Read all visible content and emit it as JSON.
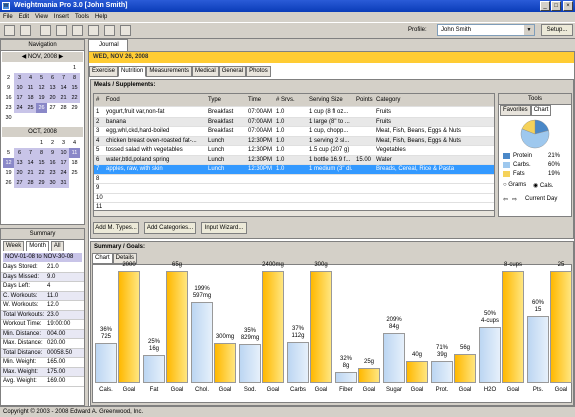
{
  "window": {
    "title": "Weightmania Pro 3.0 [John Smith]"
  },
  "menu": [
    "File",
    "Edit",
    "View",
    "Insert",
    "Tools",
    "Help"
  ],
  "profile": {
    "label": "Profile:",
    "value": "John Smith",
    "setup": "Setup..."
  },
  "navigation": {
    "title": "Navigation",
    "cal1": {
      "month": "NOV, 2008",
      "days": [
        "1",
        "2",
        "3",
        "4",
        "5",
        "6",
        "7",
        "8",
        "9",
        "10",
        "11",
        "12",
        "13",
        "14",
        "15",
        "16",
        "17",
        "18",
        "19",
        "20",
        "21",
        "22",
        "23",
        "24",
        "25",
        "26",
        "27",
        "28",
        "29",
        "30"
      ]
    },
    "cal2": {
      "month": "OCT, 2008",
      "days": [
        "1",
        "2",
        "3",
        "4",
        "5",
        "6",
        "7",
        "8",
        "9",
        "10",
        "11",
        "12",
        "13",
        "14",
        "15",
        "16",
        "17",
        "18",
        "19",
        "20",
        "21",
        "22",
        "23",
        "24",
        "25",
        "26",
        "27",
        "28",
        "29",
        "30",
        "31"
      ]
    }
  },
  "summary": {
    "title": "Summary",
    "tabs": [
      "Week",
      "Month",
      "All"
    ],
    "period": "NOV-01-08 to NOV-30-08",
    "rows": [
      [
        "Days Stored:",
        "21.0"
      ],
      [
        "Days Missed:",
        "9.0"
      ],
      [
        "Days Left:",
        "4"
      ],
      [
        "C. Workouts:",
        "11.0"
      ],
      [
        "W. Workouts:",
        "12.0"
      ],
      [
        "Total Workouts:",
        "23.0"
      ],
      [
        "Workout Time:",
        "19:00:00"
      ],
      [
        "Min. Distance:",
        "004.00"
      ],
      [
        "Max. Distance:",
        "020.00"
      ],
      [
        "Total Distance:",
        "00058.50"
      ],
      [
        "Min. Weight:",
        "165.00"
      ],
      [
        "Max. Weight:",
        "175.00"
      ],
      [
        "Avg. Weight:",
        "169.00"
      ]
    ]
  },
  "journal": {
    "tab": "Journal",
    "date": "WED, NOV 26, 2008",
    "subtabs": [
      "Exercise",
      "Nutrition",
      "Measurements",
      "Medical",
      "General",
      "Photos"
    ]
  },
  "meals": {
    "title": "Meals / Supplements:",
    "columns": [
      "#",
      "Food",
      "Type",
      "Time",
      "# Srvs.",
      "Serving Size",
      "Points",
      "Category"
    ],
    "rows": [
      [
        "1",
        "yogurt,fruit var,non-fat",
        "Breakfast",
        "07:00AM",
        "1.0",
        "1 cup (8 fl oz...",
        "",
        "Fruits"
      ],
      [
        "2",
        "banana",
        "Breakfast",
        "07:00AM",
        "1.0",
        "1 large (8\" to ...",
        "",
        "Fruits"
      ],
      [
        "3",
        "egg,whl,ckd,hard-boiled",
        "Breakfast",
        "07:00AM",
        "1.0",
        "1 cup, chopp...",
        "",
        "Meat, Fish, Beans, Eggs & Nuts"
      ],
      [
        "4",
        "chicken breast  oven-roasted  fat-...",
        "Lunch",
        "12:30PM",
        "1.0",
        "1 serving 2 sl...",
        "",
        "Meat, Fish, Beans, Eggs & Nuts"
      ],
      [
        "5",
        "tossed salad with vegetables",
        "Lunch",
        "12:30PM",
        "1.0",
        "1.5 cup (207 g)",
        "",
        "Vegetables"
      ],
      [
        "6",
        "water,btld,poland spring",
        "Lunch",
        "12:30PM",
        "1.0",
        "1 bottle 16.9 f...",
        "15.00",
        "Water"
      ],
      [
        "7",
        "apples, raw, with skin",
        "Lunch",
        "12:30PM",
        "1.0",
        "1 medium (3\" di...",
        "",
        "Breads, Cereal, Rice & Pasta"
      ],
      [
        "8",
        "",
        "",
        "",
        "",
        "",
        "",
        ""
      ],
      [
        "9",
        "",
        "",
        "",
        "",
        "",
        "",
        ""
      ],
      [
        "10",
        "",
        "",
        "",
        "",
        "",
        "",
        ""
      ],
      [
        "11",
        "",
        "",
        "",
        "",
        "",
        "",
        ""
      ]
    ],
    "buttons": [
      "Add M. Types...",
      "Add Categories...",
      "Input Wizard..."
    ]
  },
  "tools": {
    "title": "Tools",
    "tabs": [
      "Favorites",
      "Chart"
    ],
    "legend": [
      [
        "Protein",
        "21%"
      ],
      [
        "Carbs.",
        "60%"
      ],
      [
        "Fats",
        "19%"
      ]
    ],
    "radios": [
      "Grams",
      "Cals."
    ],
    "nav": "Current Day",
    "colors": [
      "#f5d25a",
      "#9ec8ee",
      "#4a88c8"
    ]
  },
  "goals": {
    "title": "Summary / Goals:",
    "tabs": [
      "Chart",
      "Details"
    ],
    "bars": [
      {
        "x": "Cals.",
        "pct": "36%",
        "val": "725",
        "f": 0.36,
        "goal": "2000",
        "gx": "Goal"
      },
      {
        "x": "Fat",
        "pct": "25%",
        "val": "16g",
        "f": 0.25,
        "goal": "65g",
        "gx": "Goal"
      },
      {
        "x": "Chol.",
        "pct": "199%",
        "val": "597mg",
        "f": 0.72,
        "goal": "300mg",
        "gx": "Goal",
        "gf": 0.36
      },
      {
        "x": "Sod.",
        "pct": "35%",
        "val": "829mg",
        "f": 0.35,
        "goal": "2400mg",
        "gx": "Goal"
      },
      {
        "x": "Carbs",
        "pct": "37%",
        "val": "112g",
        "f": 0.37,
        "goal": "300g",
        "gx": "Goal"
      },
      {
        "x": "Fiber",
        "pct": "32%",
        "val": "8g",
        "f": 0.1,
        "goal": "25g",
        "gx": "Goal",
        "gf": 0.13
      },
      {
        "x": "Sugar",
        "pct": "209%",
        "val": "84g",
        "f": 0.45,
        "goal": "40g",
        "gx": "Goal",
        "gf": 0.2
      },
      {
        "x": "Prot.",
        "pct": "71%",
        "val": "39g",
        "f": 0.2,
        "goal": "56g",
        "gx": "Goal",
        "gf": 0.26
      },
      {
        "x": "H2O",
        "pct": "50%",
        "val": "4-cups",
        "f": 0.5,
        "goal": "8-cups",
        "gx": "Goal"
      },
      {
        "x": "Pts.",
        "pct": "60%",
        "val": "15",
        "f": 0.6,
        "goal": "25",
        "gx": "Goal"
      }
    ]
  },
  "status": "Copyright © 2003 - 2008 Edward A. Greenwood, Inc."
}
